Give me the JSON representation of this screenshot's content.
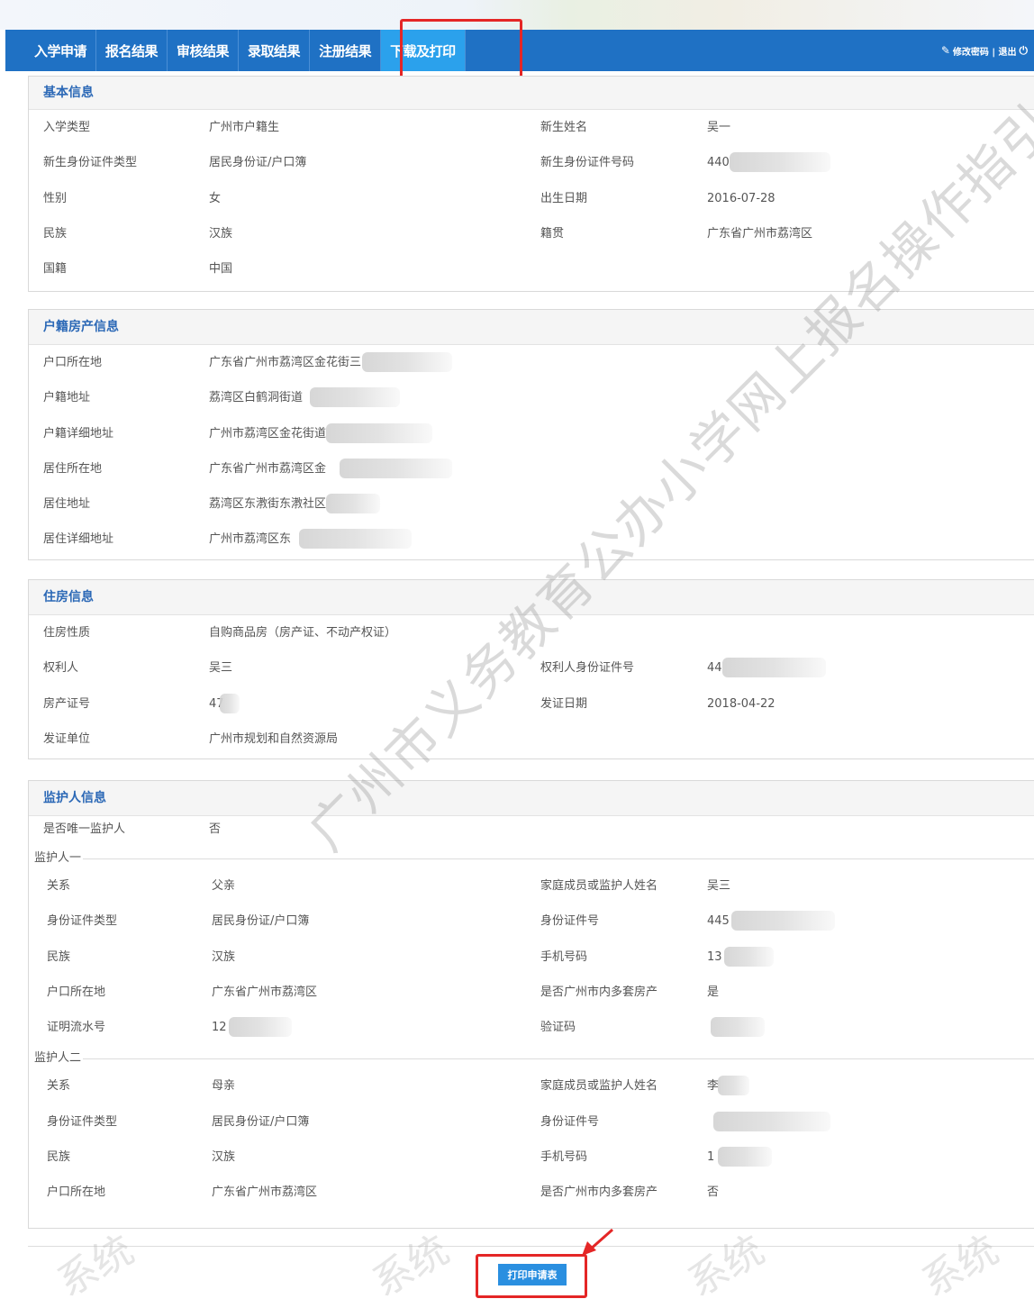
{
  "nav": {
    "tabs": [
      "入学申请",
      "报名结果",
      "审核结果",
      "录取结果",
      "注册结果",
      "下载及打印"
    ],
    "active_index": 5,
    "right_text": "修改密码 | 退出"
  },
  "basic": {
    "title": "基本信息",
    "rows": [
      {
        "l1": "入学类型",
        "v1": "广州市户籍生",
        "l2": "新生姓名",
        "v2": "吴一"
      },
      {
        "l1": "新生身份证件类型",
        "v1": "居民身份证/户口簿",
        "l2": "新生身份证件号码",
        "v2": "440"
      },
      {
        "l1": "性别",
        "v1": "女",
        "l2": "出生日期",
        "v2": "2016-07-28"
      },
      {
        "l1": "民族",
        "v1": "汉族",
        "l2": "籍贯",
        "v2": "广东省广州市荔湾区"
      },
      {
        "l1": "国籍",
        "v1": "中国",
        "l2": "",
        "v2": ""
      }
    ]
  },
  "household": {
    "title": "户籍房产信息",
    "rows": [
      {
        "l1": "户口所在地",
        "v1": "广东省广州市荔湾区金花街三"
      },
      {
        "l1": "户籍地址",
        "v1": "荔湾区白鹤洞街道"
      },
      {
        "l1": "户籍详细地址",
        "v1": "广州市荔湾区金花街道"
      },
      {
        "l1": "居住所在地",
        "v1": "广东省广州市荔湾区金"
      },
      {
        "l1": "居住地址",
        "v1": "荔湾区东漖街东漖社区"
      },
      {
        "l1": "居住详细地址",
        "v1": "广州市荔湾区东"
      }
    ]
  },
  "housing": {
    "title": "住房信息",
    "rows": [
      {
        "l1": "住房性质",
        "v1": "自购商品房（房产证、不动产权证）",
        "l2": "",
        "v2": ""
      },
      {
        "l1": "权利人",
        "v1": "吴三",
        "l2": "权利人身份证件号",
        "v2": "44"
      },
      {
        "l1": "房产证号",
        "v1": "47",
        "l2": "发证日期",
        "v2": "2018-04-22"
      },
      {
        "l1": "发证单位",
        "v1": "广州市规划和自然资源局",
        "l2": "",
        "v2": ""
      }
    ]
  },
  "guardian": {
    "title": "监护人信息",
    "only_label": "是否唯一监护人",
    "only_value": "否",
    "g1": {
      "legend": "监护人一",
      "rows": [
        {
          "l1": "关系",
          "v1": "父亲",
          "l2": "家庭成员或监护人姓名",
          "v2": "吴三"
        },
        {
          "l1": "身份证件类型",
          "v1": "居民身份证/户口簿",
          "l2": "身份证件号",
          "v2": "445"
        },
        {
          "l1": "民族",
          "v1": "汉族",
          "l2": "手机号码",
          "v2": "13"
        },
        {
          "l1": "户口所在地",
          "v1": "广东省广州市荔湾区",
          "l2": "是否广州市内多套房产",
          "v2": "是"
        },
        {
          "l1": "证明流水号",
          "v1": "12",
          "l2": "验证码",
          "v2": ""
        }
      ]
    },
    "g2": {
      "legend": "监护人二",
      "rows": [
        {
          "l1": "关系",
          "v1": "母亲",
          "l2": "家庭成员或监护人姓名",
          "v2": "李"
        },
        {
          "l1": "身份证件类型",
          "v1": "居民身份证/户口簿",
          "l2": "身份证件号",
          "v2": ""
        },
        {
          "l1": "民族",
          "v1": "汉族",
          "l2": "手机号码",
          "v2": "1"
        },
        {
          "l1": "户口所在地",
          "v1": "广东省广州市荔湾区",
          "l2": "是否广州市内多套房产",
          "v2": "否"
        }
      ]
    }
  },
  "print_button": "打印申请表",
  "watermark": "广州市义务教育公办小学网上报名操作指引",
  "footer_watermark": "系统"
}
